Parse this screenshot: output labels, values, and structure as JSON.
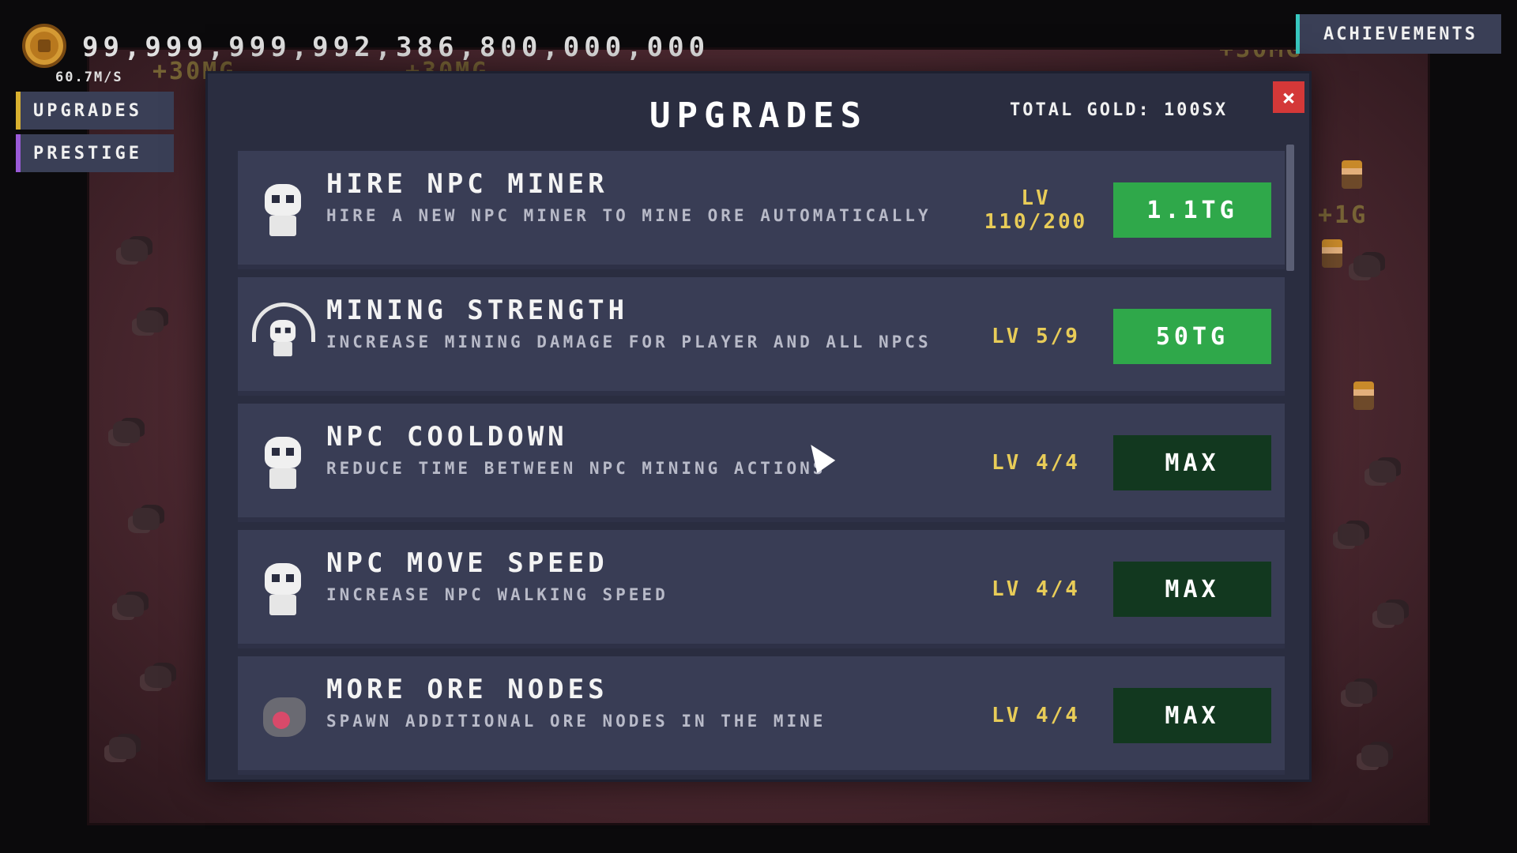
{
  "hud": {
    "gold_total": "99,999,999,992,386,800,000,000",
    "gold_rate": "60.7M/S",
    "achievements_label": "ACHIEVEMENTS",
    "side_buttons": [
      "UPGRADES",
      "PRESTIGE"
    ],
    "floating_text": [
      "+30MG",
      "+30MG",
      "+30MG",
      "+30MG",
      "+30MG",
      "+1G"
    ]
  },
  "modal": {
    "title": "UPGRADES",
    "total_gold": "TOTAL GOLD: 100SX",
    "close_label": "×",
    "upgrades": [
      {
        "name": "HIRE NPC MINER",
        "desc": "HIRE A NEW NPC MINER TO MINE ORE AUTOMATICALLY",
        "level": "LV\n110/200",
        "button": "1.1TG",
        "state": "buy",
        "icon": "npc-skull-icon"
      },
      {
        "name": "MINING STRENGTH",
        "desc": "INCREASE MINING DAMAGE FOR PLAYER AND ALL NPCS",
        "level": "LV 5/9",
        "button": "50TG",
        "state": "buy",
        "icon": "mining-strength-icon"
      },
      {
        "name": "NPC COOLDOWN",
        "desc": "REDUCE TIME BETWEEN NPC MINING ACTIONS",
        "level": "LV 4/4",
        "button": "MAX",
        "state": "max",
        "icon": "npc-skull-icon"
      },
      {
        "name": "NPC MOVE SPEED",
        "desc": "INCREASE NPC WALKING SPEED",
        "level": "LV 4/4",
        "button": "MAX",
        "state": "max",
        "icon": "npc-skull-icon"
      },
      {
        "name": "MORE ORE NODES",
        "desc": "SPAWN ADDITIONAL ORE NODES IN THE MINE",
        "level": "LV 4/4",
        "button": "MAX",
        "state": "max",
        "icon": "ore-node-icon"
      }
    ]
  },
  "colors": {
    "buy": "#2fa84a",
    "max": "#12381f",
    "level": "#e8cc58",
    "close": "#d43838"
  }
}
